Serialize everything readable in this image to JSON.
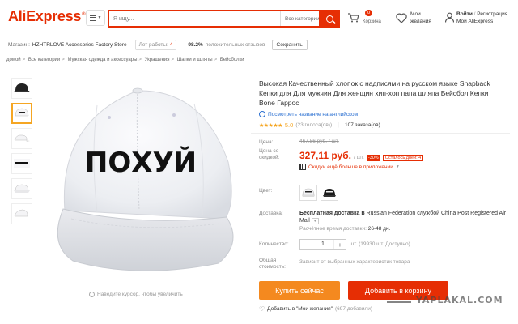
{
  "header": {
    "logo": "AliExpress",
    "search_placeholder": "Я ищу...",
    "search_category": "Все категории",
    "cart_count": "0",
    "cart_label": "Корзина",
    "wishlist_label": "Мои желания",
    "login_label": "Войти",
    "register_label": "Регистрация",
    "account_label": "Мой AliExpress"
  },
  "store": {
    "label": "Магазин:",
    "name": "HZHTRLOVE Accessories Factory Store",
    "years_label": "Лет работы:",
    "years_value": "4",
    "positive_pct": "98.2%",
    "positive_label": "положительных отзывов",
    "save_label": "Сохранить"
  },
  "breadcrumb": [
    "домой",
    "Все категории",
    "Мужская одежда и аксессуары",
    "Украшения",
    "Шапки и шляпы",
    "Бейсболки"
  ],
  "gallery": {
    "main_text": "ПОХУЙ",
    "zoom_hint": "Наведите курсор, чтобы увеличить"
  },
  "product": {
    "title": "Высокая Качественный хлопок с надписями на русском языке Snapback Кепки для Для мужчин Для женщин хип-хоп папа шляпа Бейсбол Кепки Bone Гаррос",
    "translate_label": "Посмотреть название на английском",
    "stars": "★★★★★",
    "rating": "5.0",
    "votes": "(23 голоса(ов))",
    "orders": "107 заказа(ов)",
    "price_label": "Цена:",
    "old_price": "467,56 руб.",
    "old_unit": "/ шт.",
    "sale_label": "Цена со скидкой:",
    "price": "327,11 руб.",
    "unit": "/ шт.",
    "discount": "-30%",
    "days_left": "Осталось дней: 4",
    "app_discount": "Скидки ещё больше в приложении",
    "color_label": "Цвет:",
    "shipping_label": "Доставка:",
    "shipping_free": "Бесплатная доставка в",
    "shipping_dest": "Russian Federation службой China Post Registered Air Mail",
    "delivery_label": "Расчётное время доставки:",
    "delivery_value": "26-48 дн.",
    "qty_label": "Количество:",
    "qty_minus": "−",
    "qty_value": "1",
    "qty_plus": "+",
    "qty_note": "шт. (19930 шт. Доступно)",
    "total_label": "Общая стоимость:",
    "total_note": "Зависит от выбранных характеристик товара",
    "buy_now": "Купить сейчас",
    "add_cart": "Добавить в корзину",
    "wish_add": "Добавить в \"Мои желания\"",
    "wish_count": "(697 добавили)"
  },
  "watermark": "YAPLAKAL.COM",
  "colors": {
    "brand": "#e62e04",
    "buy": "#f4891f",
    "star": "#f5a623",
    "link": "#2a6fd1"
  }
}
